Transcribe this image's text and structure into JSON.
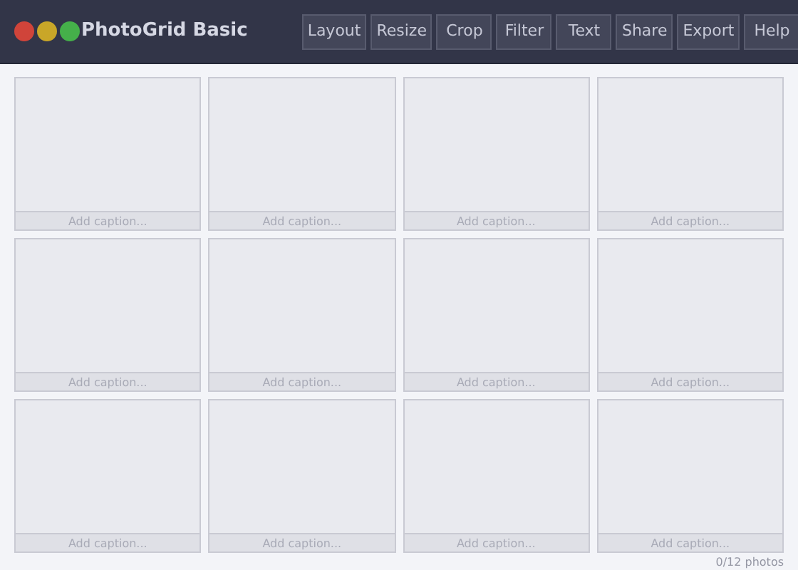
{
  "window": {
    "title": "PhotoGrid Basic",
    "controls": [
      {
        "color": "#d0443a"
      },
      {
        "color": "#c9a628"
      },
      {
        "color": "#45b04a"
      }
    ]
  },
  "toolbar": [
    "Layout",
    "Resize",
    "Crop",
    "Filter",
    "Text",
    "Share",
    "Export",
    "Help"
  ],
  "tiles": [
    {
      "placeholder": "Add caption..."
    },
    {
      "placeholder": "Add caption..."
    },
    {
      "placeholder": "Add caption..."
    },
    {
      "placeholder": "Add caption..."
    },
    {
      "placeholder": "Add caption..."
    },
    {
      "placeholder": "Add caption..."
    },
    {
      "placeholder": "Add caption..."
    },
    {
      "placeholder": "Add caption..."
    },
    {
      "placeholder": "Add caption..."
    },
    {
      "placeholder": "Add caption..."
    },
    {
      "placeholder": "Add caption..."
    },
    {
      "placeholder": "Add caption..."
    }
  ],
  "status": "0/12 photos"
}
